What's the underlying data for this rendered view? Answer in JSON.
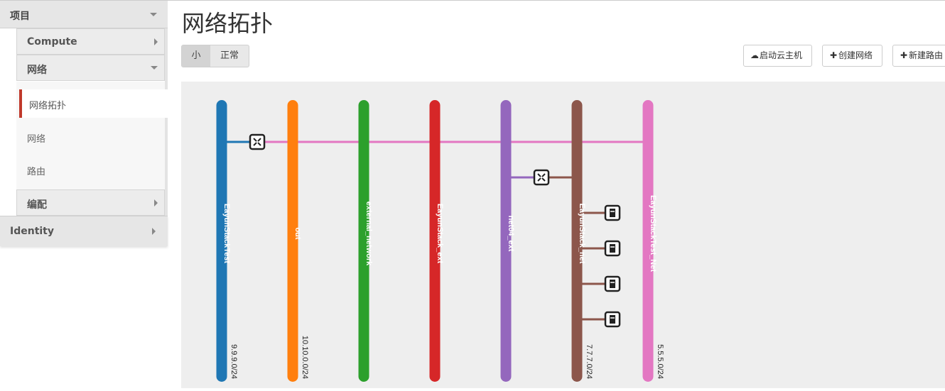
{
  "sidebar": {
    "project": "项目",
    "compute": "Compute",
    "network_group": "网络",
    "items": [
      {
        "label": "网络拓扑"
      },
      {
        "label": "网络"
      },
      {
        "label": "路由"
      }
    ],
    "orchestration": "编配",
    "identity": "Identity"
  },
  "main": {
    "title": "网络拓扑",
    "size_toggle": {
      "small": "小",
      "normal": "正常",
      "selected": "小"
    },
    "actions": [
      {
        "label": "启动云主机",
        "icon": "cloud-upload-icon"
      },
      {
        "label": "创建网络",
        "icon": "plus-icon"
      },
      {
        "label": "新建路由",
        "icon": "plus-icon"
      }
    ]
  },
  "topology": {
    "networks": [
      {
        "name": "EayunStackTest",
        "cidr": "9.9.9.0/24",
        "color": "#1f77b4"
      },
      {
        "name": "out",
        "cidr": "10.10.0.0/24",
        "color": "#ff7f0e"
      },
      {
        "name": "external_network",
        "cidr": "",
        "color": "#2ca02c"
      },
      {
        "name": "EayunStack_ext",
        "cidr": "",
        "color": "#d62728"
      },
      {
        "name": "net04_ext",
        "cidr": "",
        "color": "#9467bd"
      },
      {
        "name": "EayunStack_net",
        "cidr": "7.7.7.0/24",
        "color": "#8c564b"
      },
      {
        "name": "EayunStackTest_Net",
        "cidr": "5.5.5.0/24",
        "color": "#e377c2"
      }
    ],
    "routers": [
      {
        "icon": "router-icon",
        "networks": [
          "EayunStackTest",
          "EayunStackTest_Net"
        ]
      },
      {
        "icon": "router-icon",
        "networks": [
          "net04_ext",
          "EayunStack_net"
        ]
      }
    ],
    "instances": [
      {
        "icon": "server-icon",
        "network": "EayunStack_net"
      },
      {
        "icon": "server-icon",
        "network": "EayunStack_net"
      },
      {
        "icon": "server-icon",
        "network": "EayunStack_net"
      },
      {
        "icon": "server-icon",
        "network": "EayunStack_net"
      }
    ]
  }
}
